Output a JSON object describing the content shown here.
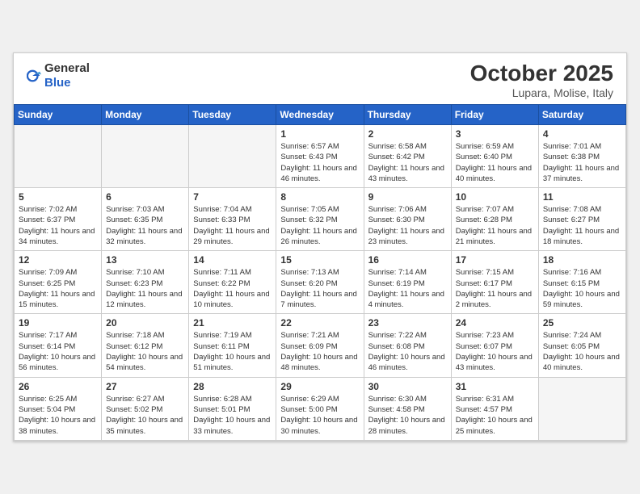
{
  "header": {
    "logo_general": "General",
    "logo_blue": "Blue",
    "month": "October 2025",
    "location": "Lupara, Molise, Italy"
  },
  "weekdays": [
    "Sunday",
    "Monday",
    "Tuesday",
    "Wednesday",
    "Thursday",
    "Friday",
    "Saturday"
  ],
  "weeks": [
    [
      {
        "day": "",
        "empty": true
      },
      {
        "day": "",
        "empty": true
      },
      {
        "day": "",
        "empty": true
      },
      {
        "day": "1",
        "sunrise": "6:57 AM",
        "sunset": "6:43 PM",
        "daylight": "11 hours and 46 minutes."
      },
      {
        "day": "2",
        "sunrise": "6:58 AM",
        "sunset": "6:42 PM",
        "daylight": "11 hours and 43 minutes."
      },
      {
        "day": "3",
        "sunrise": "6:59 AM",
        "sunset": "6:40 PM",
        "daylight": "11 hours and 40 minutes."
      },
      {
        "day": "4",
        "sunrise": "7:01 AM",
        "sunset": "6:38 PM",
        "daylight": "11 hours and 37 minutes."
      }
    ],
    [
      {
        "day": "5",
        "sunrise": "7:02 AM",
        "sunset": "6:37 PM",
        "daylight": "11 hours and 34 minutes."
      },
      {
        "day": "6",
        "sunrise": "7:03 AM",
        "sunset": "6:35 PM",
        "daylight": "11 hours and 32 minutes."
      },
      {
        "day": "7",
        "sunrise": "7:04 AM",
        "sunset": "6:33 PM",
        "daylight": "11 hours and 29 minutes."
      },
      {
        "day": "8",
        "sunrise": "7:05 AM",
        "sunset": "6:32 PM",
        "daylight": "11 hours and 26 minutes."
      },
      {
        "day": "9",
        "sunrise": "7:06 AM",
        "sunset": "6:30 PM",
        "daylight": "11 hours and 23 minutes."
      },
      {
        "day": "10",
        "sunrise": "7:07 AM",
        "sunset": "6:28 PM",
        "daylight": "11 hours and 21 minutes."
      },
      {
        "day": "11",
        "sunrise": "7:08 AM",
        "sunset": "6:27 PM",
        "daylight": "11 hours and 18 minutes."
      }
    ],
    [
      {
        "day": "12",
        "sunrise": "7:09 AM",
        "sunset": "6:25 PM",
        "daylight": "11 hours and 15 minutes."
      },
      {
        "day": "13",
        "sunrise": "7:10 AM",
        "sunset": "6:23 PM",
        "daylight": "11 hours and 12 minutes."
      },
      {
        "day": "14",
        "sunrise": "7:11 AM",
        "sunset": "6:22 PM",
        "daylight": "11 hours and 10 minutes."
      },
      {
        "day": "15",
        "sunrise": "7:13 AM",
        "sunset": "6:20 PM",
        "daylight": "11 hours and 7 minutes."
      },
      {
        "day": "16",
        "sunrise": "7:14 AM",
        "sunset": "6:19 PM",
        "daylight": "11 hours and 4 minutes."
      },
      {
        "day": "17",
        "sunrise": "7:15 AM",
        "sunset": "6:17 PM",
        "daylight": "11 hours and 2 minutes."
      },
      {
        "day": "18",
        "sunrise": "7:16 AM",
        "sunset": "6:15 PM",
        "daylight": "10 hours and 59 minutes."
      }
    ],
    [
      {
        "day": "19",
        "sunrise": "7:17 AM",
        "sunset": "6:14 PM",
        "daylight": "10 hours and 56 minutes."
      },
      {
        "day": "20",
        "sunrise": "7:18 AM",
        "sunset": "6:12 PM",
        "daylight": "10 hours and 54 minutes."
      },
      {
        "day": "21",
        "sunrise": "7:19 AM",
        "sunset": "6:11 PM",
        "daylight": "10 hours and 51 minutes."
      },
      {
        "day": "22",
        "sunrise": "7:21 AM",
        "sunset": "6:09 PM",
        "daylight": "10 hours and 48 minutes."
      },
      {
        "day": "23",
        "sunrise": "7:22 AM",
        "sunset": "6:08 PM",
        "daylight": "10 hours and 46 minutes."
      },
      {
        "day": "24",
        "sunrise": "7:23 AM",
        "sunset": "6:07 PM",
        "daylight": "10 hours and 43 minutes."
      },
      {
        "day": "25",
        "sunrise": "7:24 AM",
        "sunset": "6:05 PM",
        "daylight": "10 hours and 40 minutes."
      }
    ],
    [
      {
        "day": "26",
        "sunrise": "6:25 AM",
        "sunset": "5:04 PM",
        "daylight": "10 hours and 38 minutes."
      },
      {
        "day": "27",
        "sunrise": "6:27 AM",
        "sunset": "5:02 PM",
        "daylight": "10 hours and 35 minutes."
      },
      {
        "day": "28",
        "sunrise": "6:28 AM",
        "sunset": "5:01 PM",
        "daylight": "10 hours and 33 minutes."
      },
      {
        "day": "29",
        "sunrise": "6:29 AM",
        "sunset": "5:00 PM",
        "daylight": "10 hours and 30 minutes."
      },
      {
        "day": "30",
        "sunrise": "6:30 AM",
        "sunset": "4:58 PM",
        "daylight": "10 hours and 28 minutes."
      },
      {
        "day": "31",
        "sunrise": "6:31 AM",
        "sunset": "4:57 PM",
        "daylight": "10 hours and 25 minutes."
      },
      {
        "day": "",
        "empty": true
      }
    ]
  ]
}
